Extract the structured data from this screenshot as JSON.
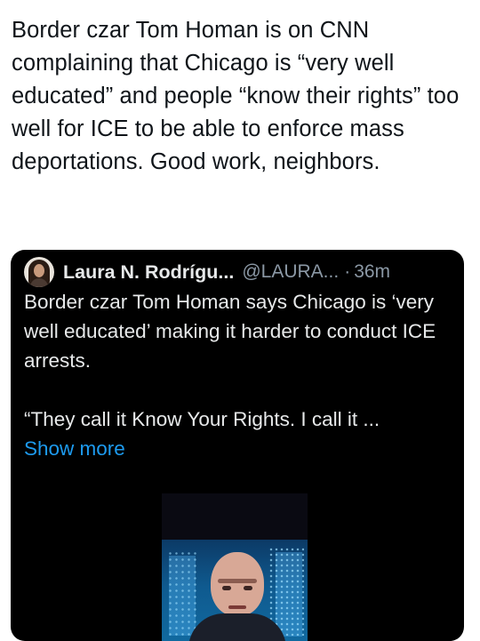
{
  "post": {
    "text": "Border czar Tom Homan is on CNN complaining that Chicago is “very well educated” and people “know their rights” too well for ICE to be able to enforce mass deportations. Good work, neighbors."
  },
  "quote": {
    "author_name": "Laura N. Rodrígu...",
    "author_handle": "@LAURA...",
    "separator": "·",
    "time": "36m",
    "text_para1": "Border czar Tom Homan says Chicago is ‘very well educated’ making it harder to conduct ICE arrests.",
    "text_para2": "“They call it Know Your Rights. I call it ...",
    "show_more": "Show more",
    "avatar_icon": "avatar-photo",
    "media_icon": "video-thumbnail"
  },
  "colors": {
    "card_bg": "#000000",
    "link": "#1d9bf0",
    "muted": "#8b98a5",
    "text_dark": "#0f1419",
    "text_light": "#e7e9ea"
  }
}
